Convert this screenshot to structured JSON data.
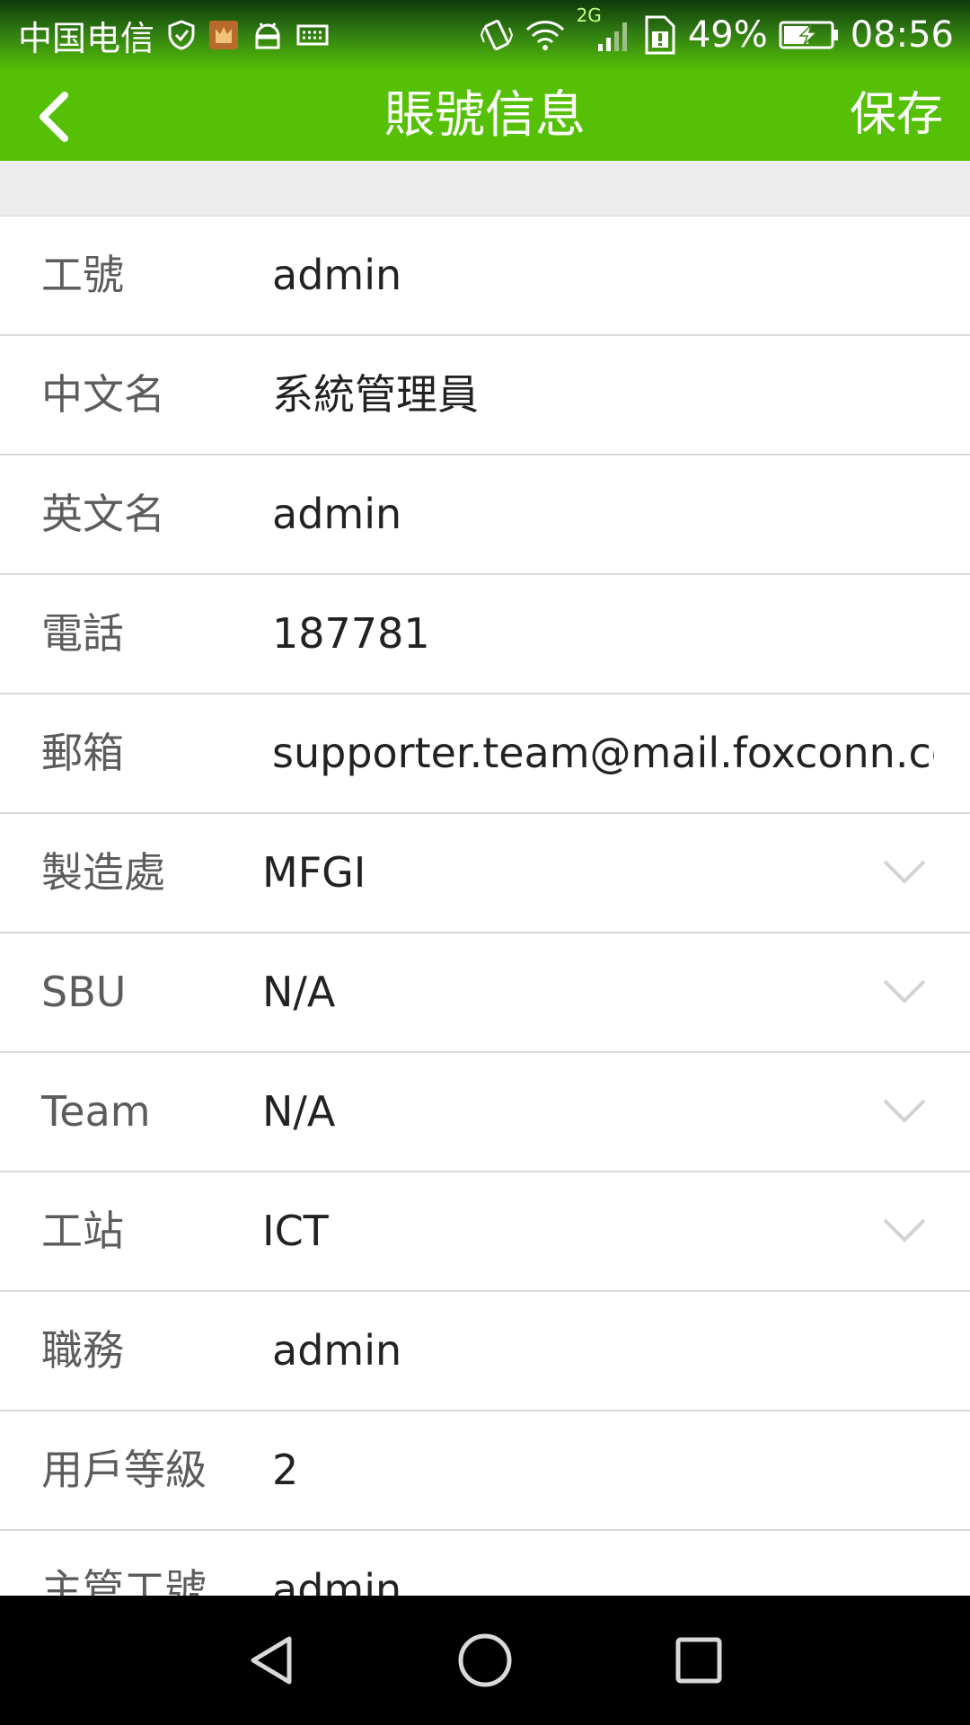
{
  "status_bar": {
    "carrier": "中国电信",
    "network_type": "2G",
    "battery": "49%",
    "time": "08:56",
    "left_icons": [
      "shield-icon",
      "app-notification-icon",
      "android-icon",
      "keyboard-icon"
    ],
    "right_icons": [
      "vibrate-icon",
      "wifi-icon",
      "signal-icon",
      "sim-icon",
      "battery-charging-icon"
    ]
  },
  "app_bar": {
    "title": "賬號信息",
    "save_label": "保存",
    "accent_color": "#55c006"
  },
  "fields": [
    {
      "label": "工號",
      "value": "admin",
      "type": "text"
    },
    {
      "label": "中文名",
      "value": "系統管理員",
      "type": "text"
    },
    {
      "label": "英文名",
      "value": "admin",
      "type": "text"
    },
    {
      "label": "電話",
      "value": "187781",
      "type": "text"
    },
    {
      "label": "郵箱",
      "value": "supporter.team@mail.foxconn.com",
      "type": "text"
    },
    {
      "label": "製造處",
      "value": "MFGI",
      "type": "select"
    },
    {
      "label": "SBU",
      "value": "N/A",
      "type": "select"
    },
    {
      "label": "Team",
      "value": "N/A",
      "type": "select"
    },
    {
      "label": "工站",
      "value": "ICT",
      "type": "select"
    },
    {
      "label": "職務",
      "value": "admin",
      "type": "text"
    },
    {
      "label": "用戶等級",
      "value": "2",
      "type": "text"
    },
    {
      "label": "主管工號",
      "value": "admin",
      "type": "text"
    }
  ],
  "nav_bar": {
    "icons": [
      "back-triangle-icon",
      "home-circle-icon",
      "recents-square-icon"
    ]
  }
}
